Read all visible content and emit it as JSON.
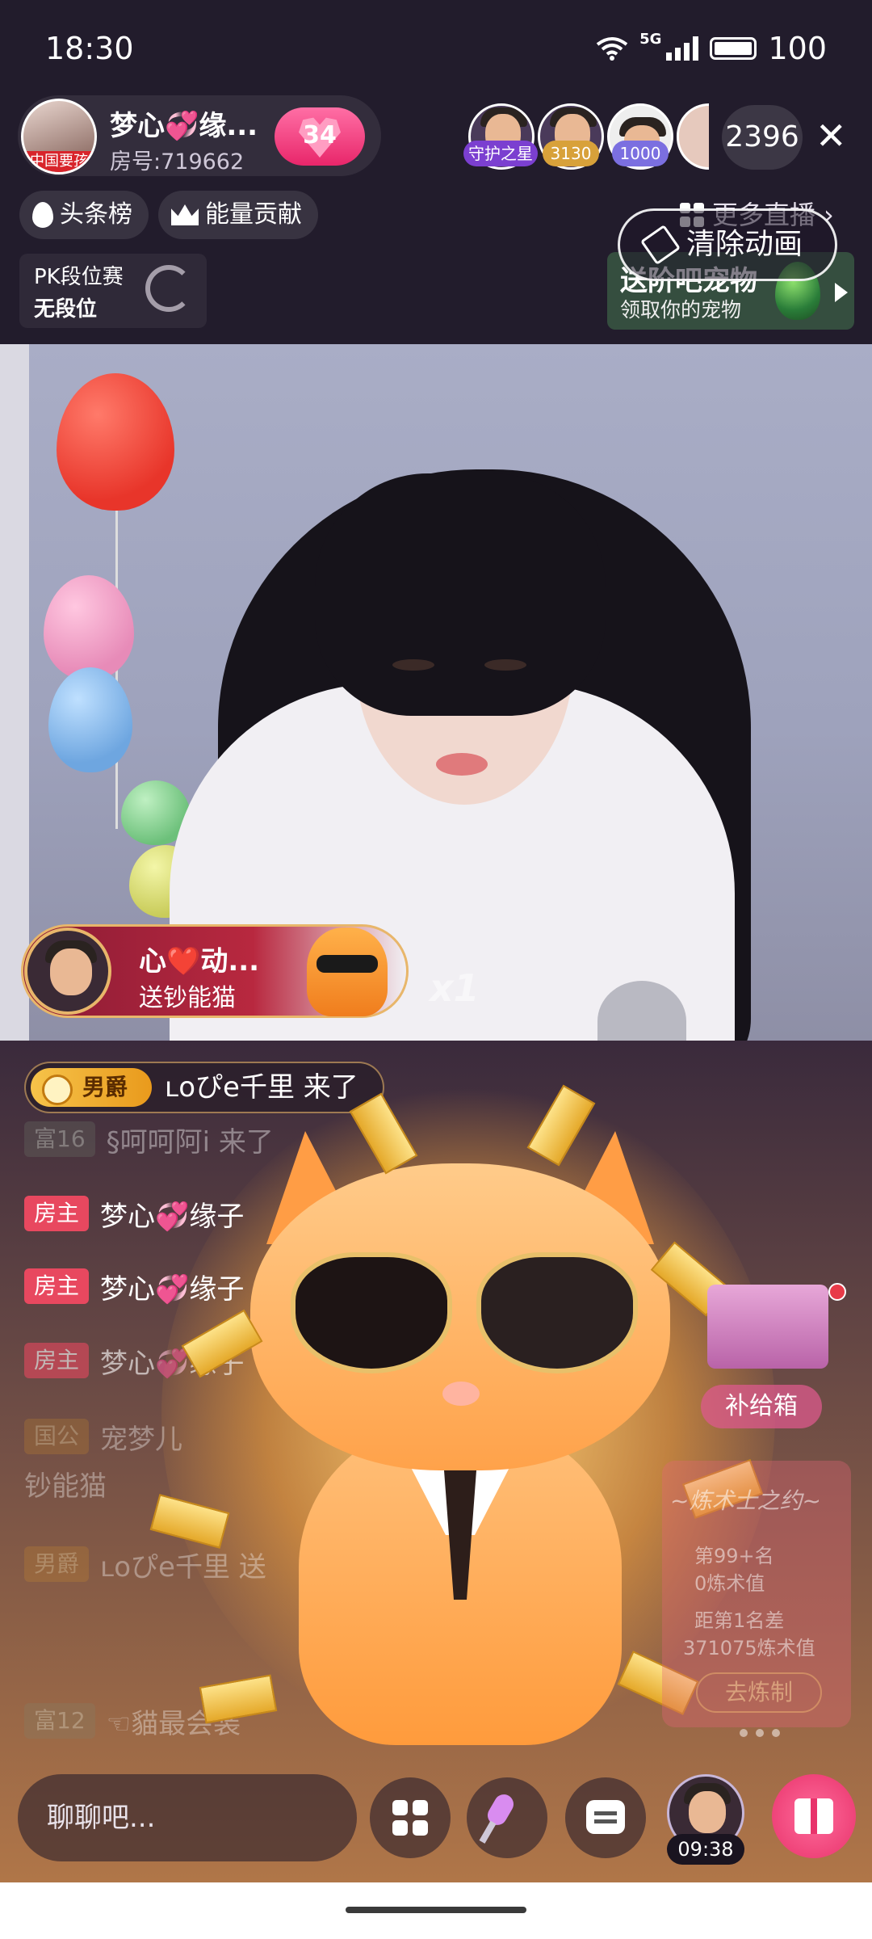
{
  "status_bar": {
    "time": "18:30",
    "network": "5G",
    "battery": "100"
  },
  "host": {
    "name": "梦心💞缘...",
    "room_no": "房号:719662",
    "avatar_tag": "中国要孩",
    "hearts": "34"
  },
  "viewers": [
    {
      "badge": "守护之星",
      "badge_color": "#7b3fd0"
    },
    {
      "badge": "3130",
      "badge_color": "#d8a13a"
    },
    {
      "badge": "1000",
      "badge_color": "#7b6fe0"
    }
  ],
  "viewer_count": "2396",
  "tabs": {
    "headlines": "头条榜",
    "energy": "能量贡献",
    "more_live": "更多直播"
  },
  "clear_animation": "清除动画",
  "pk": {
    "title": "PK段位赛",
    "rank": "无段位"
  },
  "pet_banner": {
    "title": "送阶吧宠物",
    "subtitle": "领取你的宠物"
  },
  "gift_notice": {
    "sender": "心❤️动...",
    "text": "送钞能猫",
    "count": "x1"
  },
  "entry": {
    "badge": "男爵",
    "text": "ʟoぴe千里 来了"
  },
  "chat": [
    {
      "tag": "富16",
      "text": "§呵呵阿i 来了"
    },
    {
      "tag": "房主",
      "text": "梦心💞缘子"
    },
    {
      "tag": "房主",
      "text": "梦心💞缘子"
    },
    {
      "tag": "房主",
      "text": "梦心💞缘子"
    },
    {
      "tag": "国公",
      "text": "宠梦儿"
    },
    {
      "tag": "",
      "text": "钞能猫"
    },
    {
      "tag": "男爵",
      "text": "ʟoぴe千里 送"
    },
    {
      "tag": "富12",
      "text": "☜貓最会装"
    }
  ],
  "supply": {
    "label": "补给箱"
  },
  "alchemy": {
    "title": "~炼术士之约~",
    "rank": "第99+名",
    "value": "0炼术值",
    "gap": "距第1名差",
    "gap_value": "371075炼术值",
    "button": "去炼制"
  },
  "toolbar": {
    "chat_placeholder": "聊聊吧...",
    "timer": "09:38"
  },
  "colors": {
    "accent_pink": "#e8336b",
    "gold": "#e8b66a",
    "host_tag": "#e8485f"
  },
  "icons": [
    "wifi-icon",
    "signal-icon",
    "battery-icon",
    "close-icon",
    "drop-icon",
    "crown-icon",
    "grid-icon",
    "broom-icon",
    "mic-icon",
    "chat-icon",
    "gift-icon"
  ]
}
